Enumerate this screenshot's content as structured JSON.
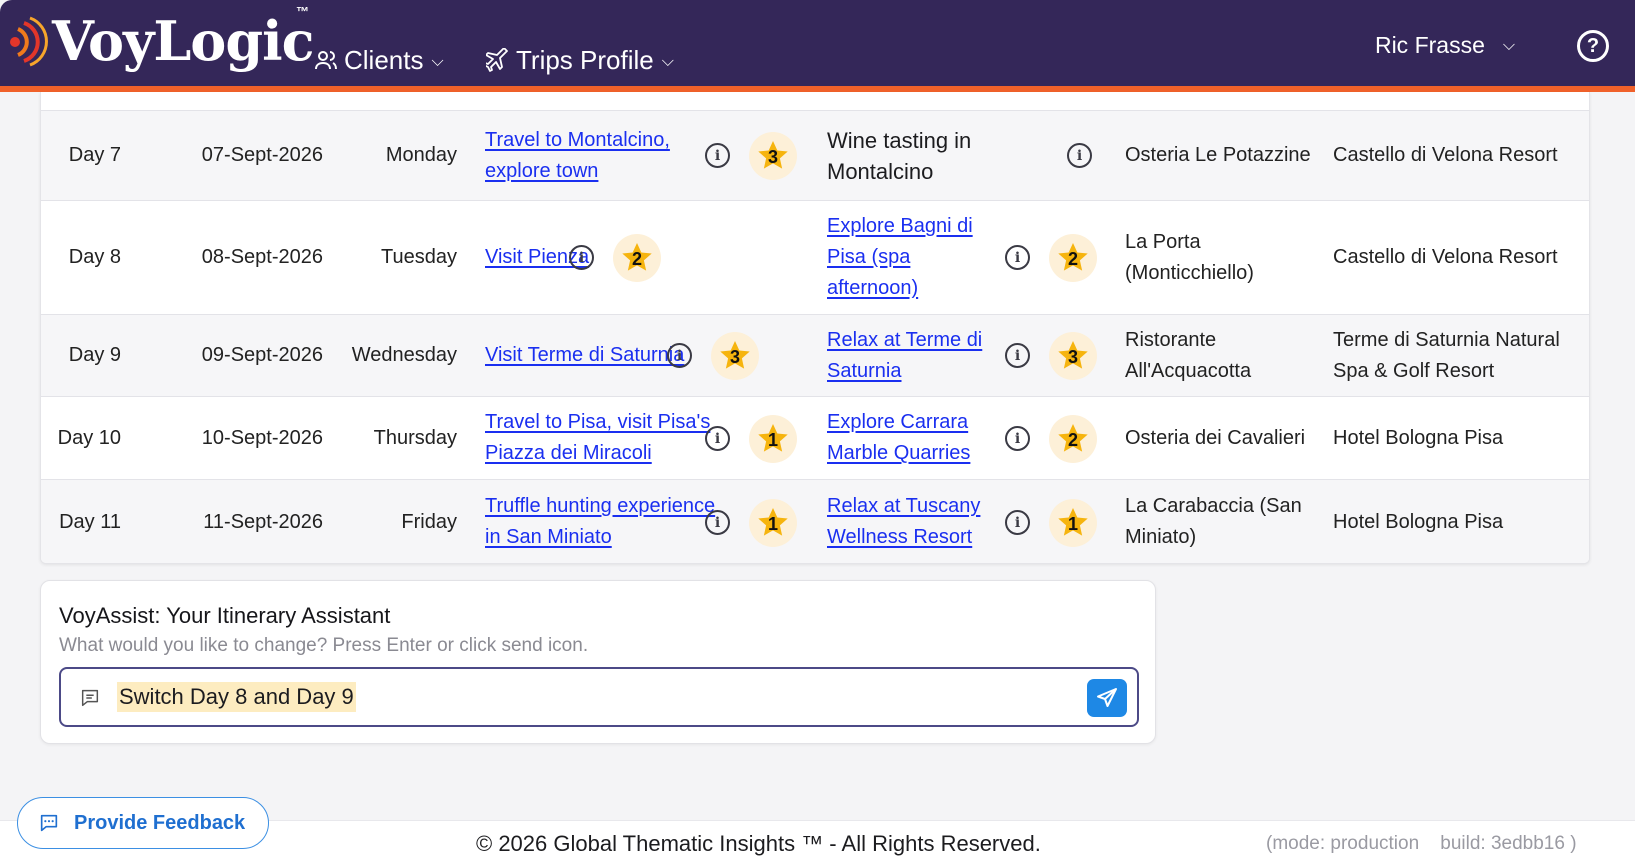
{
  "app": {
    "logo_text": "VoyLogic",
    "tm": "™",
    "nav": [
      {
        "label": "Clients",
        "icon": "users-icon"
      },
      {
        "label": "Trips Profile",
        "icon": "airplane-icon"
      }
    ],
    "user_name": "Ric Frasse",
    "help_label": "?"
  },
  "itinerary": {
    "rows": [
      {
        "day": "Day 7",
        "date": "07-Sept-2026",
        "weekday": "Monday",
        "activity1": {
          "text": "Travel to Montalcino, explore town",
          "link": true,
          "rating": "3"
        },
        "activity2": {
          "text": "Wine tasting in Montalcino",
          "link": false,
          "rating": ""
        },
        "restaurant": "Osteria Le Potazzine",
        "hotel": "Castello di Velona Resort"
      },
      {
        "day": "Day 8",
        "date": "08-Sept-2026",
        "weekday": "Tuesday",
        "activity1": {
          "text": "Visit Pienza",
          "link": true,
          "rating": "2"
        },
        "activity2": {
          "text": "Explore Bagni di Pisa (spa afternoon)",
          "link": true,
          "rating": "2"
        },
        "restaurant": "La Porta (Monticchiello)",
        "hotel": "Castello di Velona Resort"
      },
      {
        "day": "Day 9",
        "date": "09-Sept-2026",
        "weekday": "Wednesday",
        "activity1": {
          "text": "Visit Terme di Saturnia",
          "link": true,
          "rating": "3"
        },
        "activity2": {
          "text": "Relax at Terme di Saturnia",
          "link": true,
          "rating": "3"
        },
        "restaurant": "Ristorante All'Acquacotta",
        "hotel": "Terme di Saturnia Natural Spa & Golf Resort"
      },
      {
        "day": "Day 10",
        "date": "10-Sept-2026",
        "weekday": "Thursday",
        "activity1": {
          "text": "Travel to Pisa, visit Pisa's Piazza dei Miracoli",
          "link": true,
          "rating": "1"
        },
        "activity2": {
          "text": "Explore Carrara Marble Quarries",
          "link": true,
          "rating": "2"
        },
        "restaurant": "Osteria dei Cavalieri",
        "hotel": "Hotel Bologna Pisa"
      },
      {
        "day": "Day 11",
        "date": "11-Sept-2026",
        "weekday": "Friday",
        "activity1": {
          "text": "Truffle hunting experience in San Miniato",
          "link": true,
          "rating": "1"
        },
        "activity2": {
          "text": "Relax at Tuscany Wellness Resort",
          "link": true,
          "rating": "1"
        },
        "restaurant": "La Carabaccia (San Miniato)",
        "hotel": "Hotel Bologna Pisa"
      }
    ]
  },
  "assistant": {
    "title": "VoyAssist: Your Itinerary Assistant",
    "subtitle": "What would you like to change? Press Enter or click send icon.",
    "input_value": "Switch Day 8 and Day 9"
  },
  "feedback": {
    "label": "Provide Feedback"
  },
  "footer": {
    "copyright": "© 2026 Global Thematic Insights ™ - All Rights Reserved.",
    "meta": "(mode: production    build: 3edbb16 )"
  },
  "colors": {
    "header_bg": "#342759",
    "header_accent": "#f0612a",
    "link": "#1a2ff0",
    "star": "#f6b40e",
    "send_button": "#1e88e5"
  }
}
